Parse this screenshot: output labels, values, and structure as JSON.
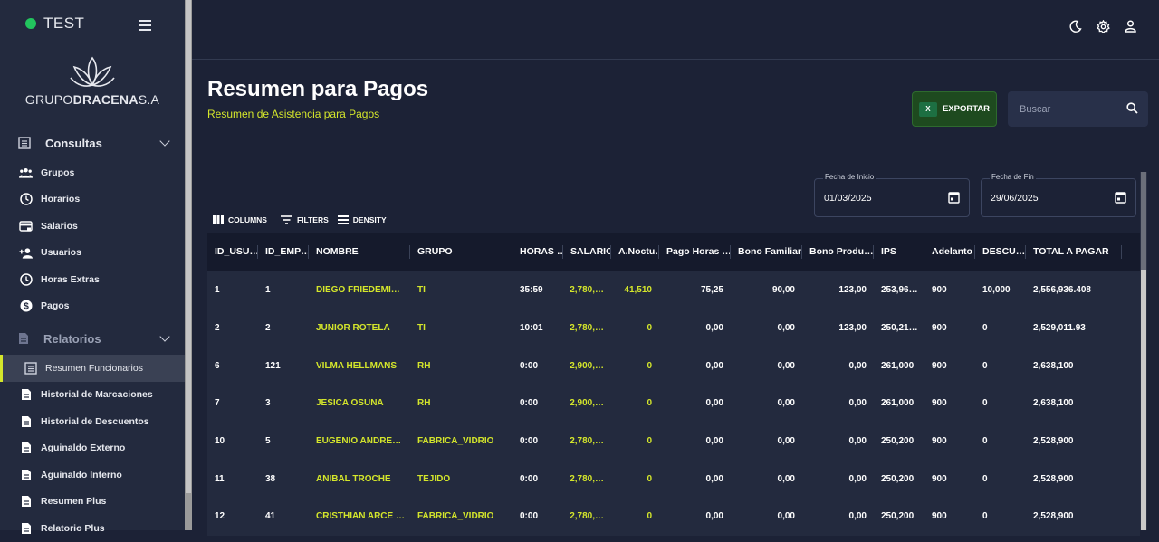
{
  "app": {
    "name": "TEST",
    "status_color": "#22c55e",
    "logo_text_a": "GRUPO",
    "logo_text_b": "DRACENA",
    "logo_text_c": "S.A"
  },
  "sidebar": {
    "sections": [
      {
        "label": "Consultas",
        "icon": "list-icon"
      },
      {
        "label": "Relatorios",
        "icon": "document-icon"
      }
    ],
    "consultas_items": [
      {
        "label": "Grupos",
        "icon": "group-icon"
      },
      {
        "label": "Horarios",
        "icon": "clock-icon"
      },
      {
        "label": "Salarios",
        "icon": "card-icon"
      },
      {
        "label": "Usuarios",
        "icon": "add-user-icon"
      },
      {
        "label": "Horas Extras",
        "icon": "clock-icon"
      },
      {
        "label": "Pagos",
        "icon": "dollar-icon"
      }
    ],
    "relatorios_items": [
      {
        "label": "Resumen Funcionarios",
        "icon": "list-icon",
        "active": true
      },
      {
        "label": "Historial de Marcaciones",
        "icon": "document-icon"
      },
      {
        "label": "Historial de Descuentos",
        "icon": "document-icon"
      },
      {
        "label": "Aguinaldo Externo",
        "icon": "document-icon"
      },
      {
        "label": "Aguinaldo Interno",
        "icon": "document-icon"
      },
      {
        "label": "Resumen Plus",
        "icon": "document-icon"
      },
      {
        "label": "Relatorio Plus",
        "icon": "document-icon"
      }
    ]
  },
  "header": {
    "title": "Resumen para Pagos",
    "subtitle": "Resumen de Asistencia para Pagos",
    "accent": "#d4e62b"
  },
  "actions": {
    "export_label": "EXPORTAR",
    "search_placeholder": "Buscar"
  },
  "filters": {
    "start": {
      "label": "Fecha de Inicio",
      "value": "01/03/2025"
    },
    "end": {
      "label": "Fecha de Fin",
      "value": "29/06/2025"
    }
  },
  "toolbar": {
    "columns": "COLUMNS",
    "filters": "FILTERS",
    "density": "DENSITY"
  },
  "table": {
    "columns": [
      "ID_USU…",
      "ID_EMP…",
      "NOMBRE",
      "GRUPO",
      "HORAS …",
      "SALARIO",
      "A.Noctu…",
      "Pago Horas …",
      "Bono Familiar",
      "Bono Produ…",
      "IPS",
      "Adelanto",
      "DESCU…",
      "TOTAL A PAGAR"
    ],
    "rows": [
      [
        "1",
        "1",
        "DIEGO FRIEDEMI…",
        "TI",
        "35:59",
        "2,780,…",
        "41,510",
        "75,25",
        "90,00",
        "123,00",
        "253,96…",
        "900",
        "10,000",
        "2,556,936.408"
      ],
      [
        "2",
        "2",
        "JUNIOR ROTELA",
        "TI",
        "10:01",
        "2,780,…",
        "0",
        "0,00",
        "0,00",
        "123,00",
        "250,21…",
        "900",
        "0",
        "2,529,011.93"
      ],
      [
        "6",
        "121",
        "VILMA HELLMANS",
        "RH",
        "0:00",
        "2,900,…",
        "0",
        "0,00",
        "0,00",
        "0,00",
        "261,000",
        "900",
        "0",
        "2,638,100"
      ],
      [
        "7",
        "3",
        "JESICA OSUNA",
        "RH",
        "0:00",
        "2,900,…",
        "0",
        "0,00",
        "0,00",
        "0,00",
        "261,000",
        "900",
        "0",
        "2,638,100"
      ],
      [
        "10",
        "5",
        "EUGENIO ANDRE…",
        "FABRICA_VIDRIO",
        "0:00",
        "2,780,…",
        "0",
        "0,00",
        "0,00",
        "0,00",
        "250,200",
        "900",
        "0",
        "2,528,900"
      ],
      [
        "11",
        "38",
        "ANIBAL TROCHE",
        "TEJIDO",
        "0:00",
        "2,780,…",
        "0",
        "0,00",
        "0,00",
        "0,00",
        "250,200",
        "900",
        "0",
        "2,528,900"
      ],
      [
        "12",
        "41",
        "CRISTHIAN ARCE …",
        "FABRICA_VIDRIO",
        "0:00",
        "2,780,…",
        "0",
        "0,00",
        "0,00",
        "0,00",
        "250,200",
        "900",
        "0",
        "2,528,900"
      ]
    ]
  }
}
